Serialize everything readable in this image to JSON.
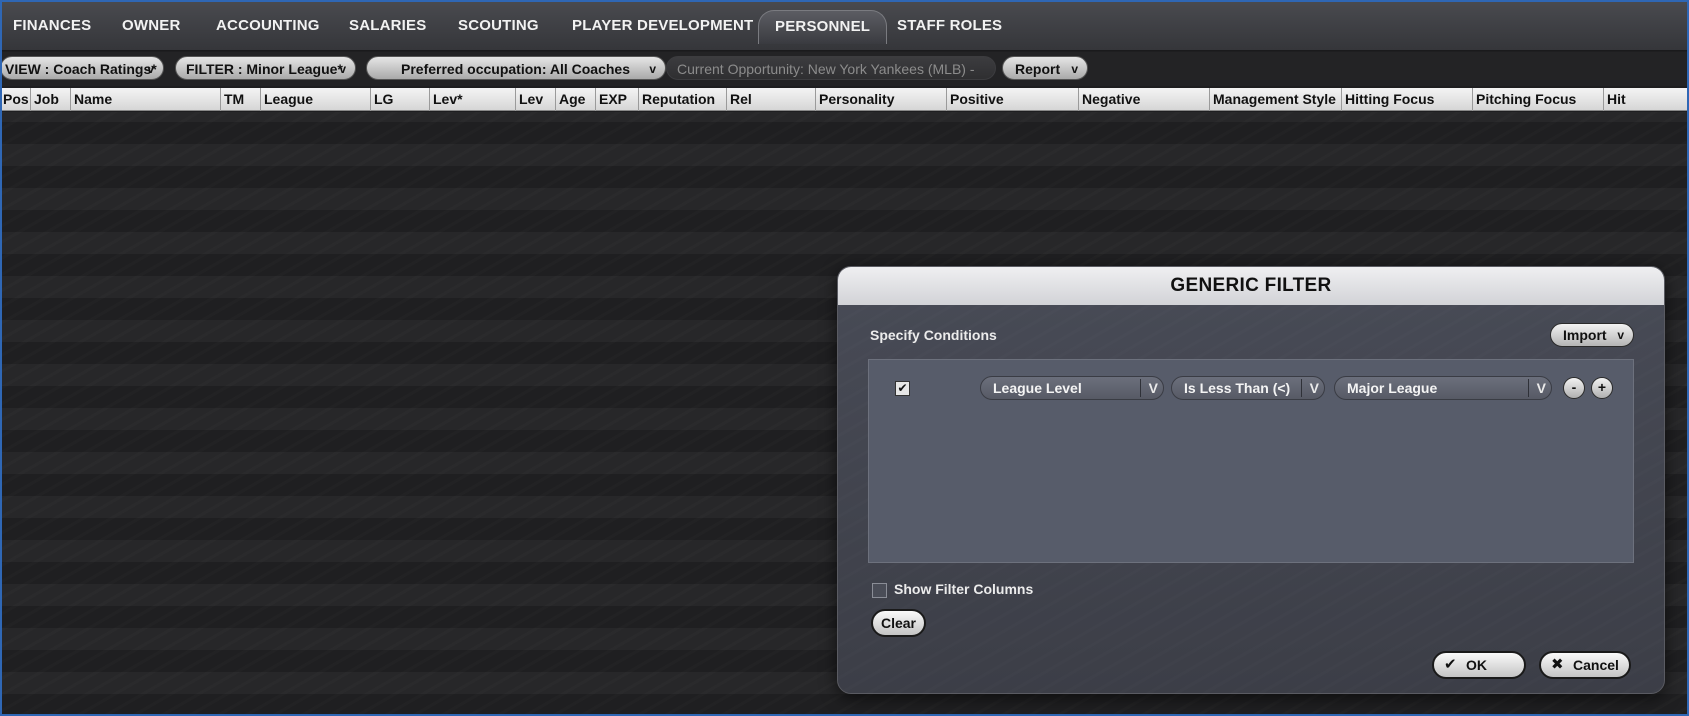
{
  "tabs": [
    {
      "label": "FINANCES",
      "active": false
    },
    {
      "label": "OWNER",
      "active": false
    },
    {
      "label": "ACCOUNTING",
      "active": false
    },
    {
      "label": "SALARIES",
      "active": false
    },
    {
      "label": "SCOUTING",
      "active": false
    },
    {
      "label": "PLAYER DEVELOPMENT",
      "active": false
    },
    {
      "label": "PERSONNEL",
      "active": true
    },
    {
      "label": "STAFF ROLES",
      "active": false
    }
  ],
  "toolbar": {
    "view_label": "VIEW : Coach Ratings*",
    "filter_label": "FILTER : Minor League*",
    "occupation_label": "Preferred occupation: All Coaches",
    "opportunity_label": "Current Opportunity: New York Yankees (MLB) -",
    "report_label": "Report",
    "chevron": "v"
  },
  "columns": [
    "Pos",
    "Job",
    "Name",
    "TM",
    "League",
    "LG",
    "Lev*",
    "Lev",
    "Age",
    "EXP",
    "Reputation",
    "Rel",
    "Personality",
    "Positive",
    "Negative",
    "Management Style",
    "Hitting Focus",
    "Pitching Focus",
    "Hit"
  ],
  "dialog": {
    "title": "GENERIC FILTER",
    "specify_label": "Specify Conditions",
    "import_label": "Import",
    "condition": {
      "enabled": true,
      "field": "League Level",
      "operator": "Is Less Than (<)",
      "value": "Major League",
      "dropdown_glyph": "V",
      "remove_label": "-",
      "add_label": "+"
    },
    "show_filter_columns_label": "Show Filter Columns",
    "show_filter_columns_checked": false,
    "clear_label": "Clear",
    "ok_label": "OK",
    "cancel_label": "Cancel",
    "ok_icon": "checkmark-icon",
    "cancel_icon": "x-icon"
  }
}
